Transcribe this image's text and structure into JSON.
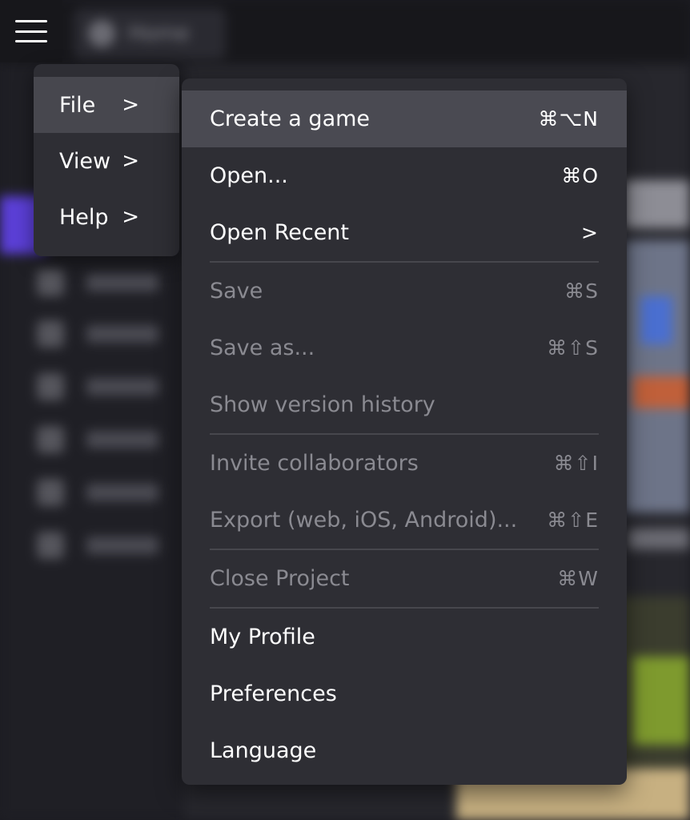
{
  "background": {
    "home_label": "Home"
  },
  "root_menu": {
    "items": [
      {
        "label": "File",
        "chevron": ">"
      },
      {
        "label": "View",
        "chevron": ">"
      },
      {
        "label": "Help",
        "chevron": ">"
      }
    ]
  },
  "file_menu": {
    "items": [
      {
        "label": "Create a game",
        "shortcut": "⌘⌥N"
      },
      {
        "label": "Open...",
        "shortcut": "⌘O"
      },
      {
        "label": "Open Recent",
        "chevron": ">"
      },
      {
        "label": "Save",
        "shortcut": "⌘S"
      },
      {
        "label": "Save as...",
        "shortcut": "⌘⇧S"
      },
      {
        "label": "Show version history"
      },
      {
        "label": "Invite collaborators",
        "shortcut": "⌘⇧I"
      },
      {
        "label": "Export (web, iOS, Android)...",
        "shortcut": "⌘⇧E"
      },
      {
        "label": "Close Project",
        "shortcut": "⌘W"
      },
      {
        "label": "My Profile"
      },
      {
        "label": "Preferences"
      },
      {
        "label": "Language"
      }
    ]
  },
  "colors": {
    "menu_bg": "#2e2e34",
    "highlight": "#4a4a52",
    "disabled_text": "#8a8a91",
    "accent": "#5b3fd6"
  },
  "icons": {
    "menu": "hamburger-icon",
    "submenu": "chevron-right-icon"
  }
}
